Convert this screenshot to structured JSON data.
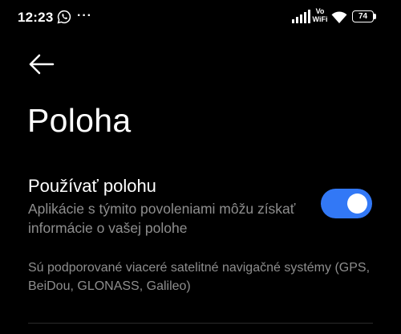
{
  "status_bar": {
    "time": "12:23",
    "notification_icons": [
      "whatsapp-icon",
      "more-dots-icon"
    ],
    "more_indicator": "···",
    "vowifi_line1": "Vo",
    "vowifi_line2": "WiFi",
    "battery_level": "74",
    "icons": [
      "signal-icon",
      "vowifi-icon",
      "wifi-icon",
      "battery-icon"
    ]
  },
  "header": {
    "back_icon": "arrow-left-icon",
    "title": "Poloha"
  },
  "location_setting": {
    "title": "Používať polohu",
    "summary": "Aplikácie s týmito povoleniami môžu získať informácie o vašej polohe",
    "enabled": true,
    "toggle_color": "#3278f6"
  },
  "info": {
    "text": "Sú podporované viaceré satelitné navigačné systémy (GPS, BeiDou, GLONASS, Galileo)"
  },
  "colors": {
    "background": "#000000",
    "primary_text": "#ffffff",
    "secondary_text": "#8e8e8e",
    "accent": "#3278f6"
  }
}
